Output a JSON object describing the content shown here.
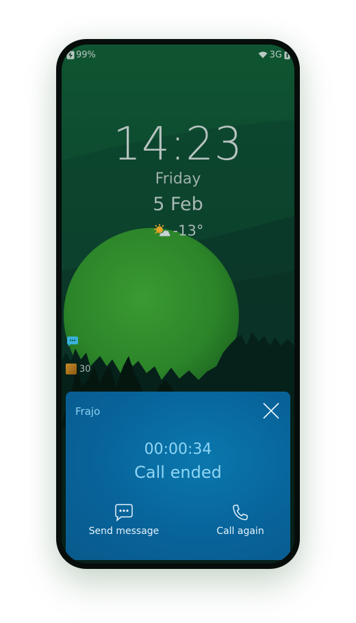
{
  "status_bar": {
    "battery_percent": "99%",
    "network": "3G",
    "icons": [
      "charging-bolt-icon",
      "wifi-icon",
      "battery-icon"
    ]
  },
  "lockscreen": {
    "time": "14:23",
    "weekday": "Friday",
    "date": "5 Feb",
    "weather": {
      "icon": "partly-sunny-icon",
      "temperature": "-13°"
    },
    "notifications": [
      {
        "icon": "chat-bubble-icon",
        "count": ""
      },
      {
        "icon": "app-icon",
        "count": "30"
      }
    ]
  },
  "call_panel": {
    "caller": "Frajo",
    "duration": "00:00:34",
    "status": "Call ended",
    "actions": {
      "send_message": "Send message",
      "call_again": "Call again"
    }
  },
  "colors": {
    "panel": "#0a6fa3",
    "accent_text": "#8fd6f5",
    "planet": "#2f8a2a",
    "sky": "#0e4a2f"
  }
}
